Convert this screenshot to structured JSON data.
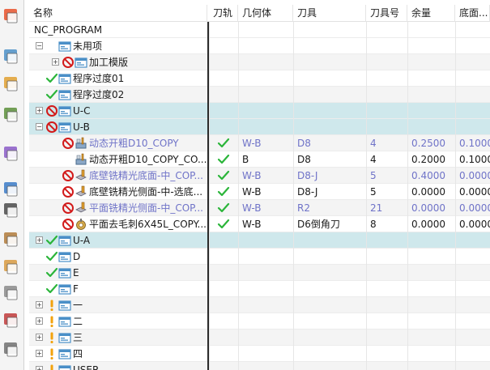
{
  "columns": {
    "name": "名称",
    "path": "刀轨",
    "geometry": "几何体",
    "tool": "刀具",
    "tool_no": "刀具号",
    "stock": "余量",
    "floor": "底面..."
  },
  "rows": [
    {
      "name": "NC_PROGRAM",
      "level": 0,
      "expander": "",
      "status": "",
      "icon": "",
      "path": "",
      "geometry": "",
      "tool": "",
      "tool_no": "",
      "stock": "",
      "floor": "",
      "style": "normal",
      "muted": false
    },
    {
      "name": "未用项",
      "level": 1,
      "expander": "−",
      "status": "",
      "icon": "program-folder",
      "path": "",
      "geometry": "",
      "tool": "",
      "tool_no": "",
      "stock": "",
      "floor": "",
      "style": "normal",
      "muted": false
    },
    {
      "name": "加工模版",
      "level": 2,
      "expander": "+",
      "status": "prohibited",
      "icon": "program-folder",
      "path": "",
      "geometry": "",
      "tool": "",
      "tool_no": "",
      "stock": "",
      "floor": "",
      "style": "alt",
      "muted": false
    },
    {
      "name": "程序过度01",
      "level": 1,
      "expander": "",
      "status": "check",
      "icon": "program-folder",
      "path": "",
      "geometry": "",
      "tool": "",
      "tool_no": "",
      "stock": "",
      "floor": "",
      "style": "normal",
      "muted": false
    },
    {
      "name": "程序过度02",
      "level": 1,
      "expander": "",
      "status": "check",
      "icon": "program-folder",
      "path": "",
      "geometry": "",
      "tool": "",
      "tool_no": "",
      "stock": "",
      "floor": "",
      "style": "alt",
      "muted": false
    },
    {
      "name": "U-C",
      "level": 1,
      "expander": "+",
      "status": "prohibited",
      "icon": "program-folder",
      "path": "",
      "geometry": "",
      "tool": "",
      "tool_no": "",
      "stock": "",
      "floor": "",
      "style": "sel",
      "muted": false
    },
    {
      "name": "U-B",
      "level": 1,
      "expander": "−",
      "status": "prohibited",
      "icon": "program-folder",
      "path": "",
      "geometry": "",
      "tool": "",
      "tool_no": "",
      "stock": "",
      "floor": "",
      "style": "sel",
      "muted": false
    },
    {
      "name": "动态开粗D10_COPY",
      "level": 2,
      "expander": "",
      "status": "prohibited",
      "icon": "cavity-mill",
      "path": "✓",
      "geometry": "W-B",
      "tool": "D8",
      "tool_no": "4",
      "stock": "0.2500",
      "floor": "0.1000",
      "style": "alt",
      "muted": true
    },
    {
      "name": "动态开粗D10_COPY_CO...",
      "level": 2,
      "expander": "",
      "status": "",
      "icon": "cavity-mill",
      "path": "✓",
      "geometry": "B",
      "tool": "D8",
      "tool_no": "4",
      "stock": "0.2000",
      "floor": "0.1000",
      "style": "normal",
      "muted": false
    },
    {
      "name": "底壁铣精光底面-中_COP...",
      "level": 2,
      "expander": "",
      "status": "prohibited",
      "icon": "floor-wall",
      "path": "✓",
      "geometry": "W-B",
      "tool": "D8-J",
      "tool_no": "5",
      "stock": "0.4000",
      "floor": "0.0000",
      "style": "alt",
      "muted": true
    },
    {
      "name": "底壁铣精光侧面-中-选底...",
      "level": 2,
      "expander": "",
      "status": "prohibited",
      "icon": "floor-wall",
      "path": "✓",
      "geometry": "W-B",
      "tool": "D8-J",
      "tool_no": "5",
      "stock": "0.0000",
      "floor": "0.0000",
      "style": "normal",
      "muted": false
    },
    {
      "name": "平面铣精光侧面-中_COP...",
      "level": 2,
      "expander": "",
      "status": "prohibited",
      "icon": "floor-wall",
      "path": "✓",
      "geometry": "W-B",
      "tool": "R2",
      "tool_no": "21",
      "stock": "0.0000",
      "floor": "0.0000",
      "style": "alt",
      "muted": true
    },
    {
      "name": "平面去毛刺6X45L_COPY...",
      "level": 2,
      "expander": "",
      "status": "prohibited",
      "icon": "deburr",
      "path": "✓",
      "geometry": "W-B",
      "tool": "D6倒角刀",
      "tool_no": "8",
      "stock": "0.0000",
      "floor": "0.0000",
      "style": "normal",
      "muted": false
    },
    {
      "name": "U-A",
      "level": 1,
      "expander": "+",
      "status": "check",
      "icon": "program-folder",
      "path": "",
      "geometry": "",
      "tool": "",
      "tool_no": "",
      "stock": "",
      "floor": "",
      "style": "sel",
      "muted": false
    },
    {
      "name": "D",
      "level": 1,
      "expander": "",
      "status": "check",
      "icon": "program-folder",
      "path": "",
      "geometry": "",
      "tool": "",
      "tool_no": "",
      "stock": "",
      "floor": "",
      "style": "normal",
      "muted": false
    },
    {
      "name": "E",
      "level": 1,
      "expander": "",
      "status": "check",
      "icon": "program-folder",
      "path": "",
      "geometry": "",
      "tool": "",
      "tool_no": "",
      "stock": "",
      "floor": "",
      "style": "alt",
      "muted": false
    },
    {
      "name": "F",
      "level": 1,
      "expander": "",
      "status": "check",
      "icon": "program-folder",
      "path": "",
      "geometry": "",
      "tool": "",
      "tool_no": "",
      "stock": "",
      "floor": "",
      "style": "normal",
      "muted": false
    },
    {
      "name": "一",
      "level": 1,
      "expander": "+",
      "status": "warning",
      "icon": "program-folder",
      "path": "",
      "geometry": "",
      "tool": "",
      "tool_no": "",
      "stock": "",
      "floor": "",
      "style": "alt",
      "muted": false
    },
    {
      "name": "二",
      "level": 1,
      "expander": "+",
      "status": "warning",
      "icon": "program-folder",
      "path": "",
      "geometry": "",
      "tool": "",
      "tool_no": "",
      "stock": "",
      "floor": "",
      "style": "normal",
      "muted": false
    },
    {
      "name": "三",
      "level": 1,
      "expander": "+",
      "status": "warning",
      "icon": "program-folder",
      "path": "",
      "geometry": "",
      "tool": "",
      "tool_no": "",
      "stock": "",
      "floor": "",
      "style": "alt",
      "muted": false
    },
    {
      "name": "四",
      "level": 1,
      "expander": "+",
      "status": "warning",
      "icon": "program-folder",
      "path": "",
      "geometry": "",
      "tool": "",
      "tool_no": "",
      "stock": "",
      "floor": "",
      "style": "normal",
      "muted": false
    },
    {
      "name": "USER",
      "level": 1,
      "expander": "+",
      "status": "warning",
      "icon": "program-folder",
      "path": "",
      "geometry": "",
      "tool": "",
      "tool_no": "",
      "stock": "",
      "floor": "",
      "style": "alt",
      "muted": false
    }
  ],
  "toolbar": [
    {
      "icon": "orient-view-icon"
    },
    {
      "icon": "create-program-icon"
    },
    {
      "icon": "create-tool-icon"
    },
    {
      "icon": "create-geometry-icon"
    },
    {
      "icon": "create-method-icon"
    },
    {
      "icon": "regenerate-icon"
    },
    {
      "icon": "list-icon"
    },
    {
      "icon": "part-icon"
    },
    {
      "icon": "workpiece-icon"
    },
    {
      "icon": "cube-icon"
    },
    {
      "icon": "measure-icon"
    },
    {
      "icon": "analysis-icon"
    }
  ],
  "colors": {
    "selected_row": "#cfe8ec",
    "alt_row": "#f4f4f4",
    "muted_text": "#6f73c8",
    "check": "#2bb53a",
    "prohibited": "#d21a1a",
    "warning": "#f2a20c",
    "folder": "#4a8fc7"
  }
}
